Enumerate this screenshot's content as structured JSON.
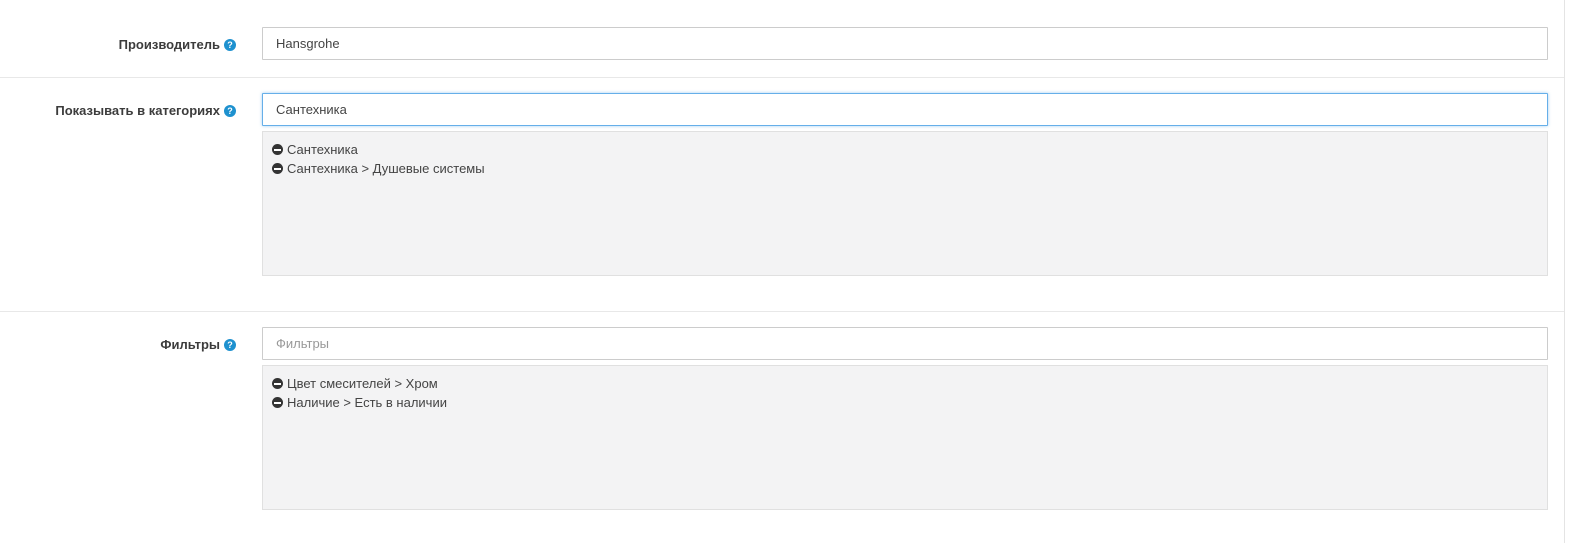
{
  "manufacturer": {
    "label": "Производитель",
    "value": "Hansgrohe",
    "help_icon": "question-circle-icon"
  },
  "categories": {
    "label": "Показывать в категориях",
    "value": "Сантехника",
    "help_icon": "question-circle-icon",
    "items": [
      "Сантехника",
      "Сантехника > Душевые системы"
    ]
  },
  "filters": {
    "label": "Фильтры",
    "value": "",
    "placeholder": "Фильтры",
    "help_icon": "question-circle-icon",
    "items": [
      "Цвет смесителей > Хром",
      "Наличие > Есть в наличии"
    ]
  },
  "help_glyph": "?",
  "colors": {
    "help_icon": "#1e91cf",
    "focus_border": "#66afe9",
    "well_bg": "#f3f3f4"
  }
}
